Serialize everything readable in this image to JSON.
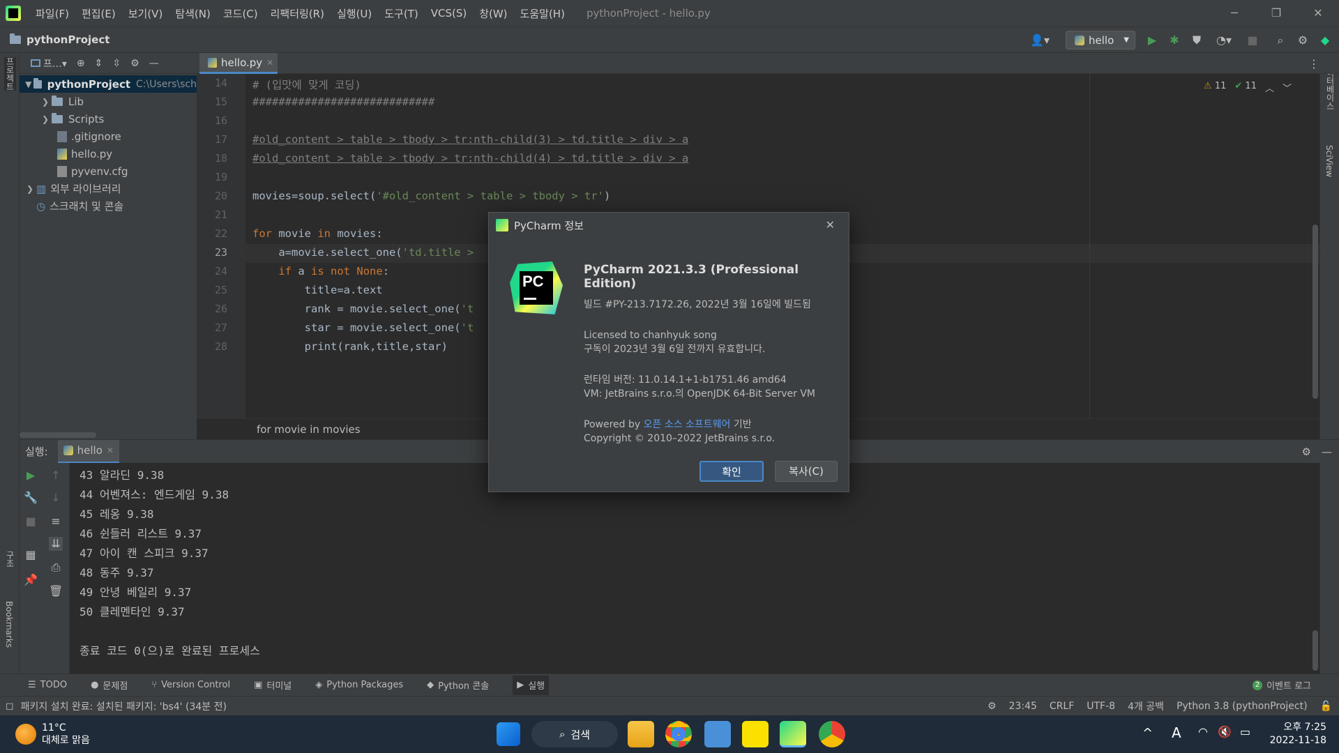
{
  "menu": {
    "items": [
      "파일(F)",
      "편집(E)",
      "보기(V)",
      "탐색(N)",
      "코드(C)",
      "리팩터링(R)",
      "실행(U)",
      "도구(T)",
      "VCS(S)",
      "창(W)",
      "도움말(H)"
    ],
    "window_title": "pythonProject - hello.py"
  },
  "nav": {
    "project": "pythonProject",
    "run_config": "hello"
  },
  "side": {
    "project_label": "프로젝트",
    "structure_label": "구조",
    "bookmarks_label": "Bookmarks",
    "db_label": "데이터베이스",
    "sciview_label": "SciView"
  },
  "project_panel": {
    "dropdown": "프…",
    "root": "pythonProject",
    "root_path": "C:\\Users\\sch",
    "items": [
      "Lib",
      "Scripts",
      ".gitignore",
      "hello.py",
      "pyvenv.cfg"
    ],
    "ext_lib": "외부 라이브러리",
    "scratch": "스크래치 및 콘솔"
  },
  "editor": {
    "tab": "hello.py",
    "warnings": "11",
    "checks": "11",
    "lines": [
      {
        "n": "14",
        "t": "# (입맛에 맞게 코딩)"
      },
      {
        "n": "15",
        "t": "############################"
      },
      {
        "n": "16",
        "t": ""
      },
      {
        "n": "17",
        "t": "#old_content > table > tbody > tr:nth-child(3) > td.title > div > a"
      },
      {
        "n": "18",
        "t": "#old_content > table > tbody > tr:nth-child(4) > td.title > div > a"
      },
      {
        "n": "19",
        "t": ""
      },
      {
        "n": "20",
        "t": "movies=soup.select('#old_content > table > tbody > tr')"
      },
      {
        "n": "21",
        "t": ""
      },
      {
        "n": "22",
        "t": "for movie in movies:"
      },
      {
        "n": "23",
        "t": "    a=movie.select_one('td.title >"
      },
      {
        "n": "24",
        "t": "    if a is not None:"
      },
      {
        "n": "25",
        "t": "        title=a.text"
      },
      {
        "n": "26",
        "t": "        rank = movie.select_one('t"
      },
      {
        "n": "27",
        "t": "        star = movie.select_one('t"
      },
      {
        "n": "28",
        "t": "        print(rank,title,star)"
      }
    ],
    "breadcrumb": "for movie in movies"
  },
  "run": {
    "label": "실행:",
    "tab": "hello",
    "output": [
      "43 알라딘 9.38",
      "44 어벤져스: 엔드게임 9.38",
      "45 레옹 9.38",
      "46 쉰들러 리스트 9.37",
      "47 아이 캔 스피크 9.37",
      "48 동주 9.37",
      "49 안녕 베일리 9.37",
      "50 클레멘타인 9.37",
      "",
      "종료 코드 0(으)로 완료된 프로세스"
    ]
  },
  "toolwindows": {
    "todo": "TODO",
    "problems": "문제점",
    "vcs": "Version Control",
    "terminal": "터미널",
    "packages": "Python Packages",
    "console": "Python 콘솔",
    "run": "실행",
    "event_count": "2",
    "event_log": "이벤트 로그"
  },
  "status": {
    "message": "패키지 설치 완료: 설치된 패키지: 'bs4' (34분 전)",
    "position": "23:45",
    "line_sep": "CRLF",
    "encoding": "UTF-8",
    "indent": "4개 공백",
    "interpreter": "Python 3.8 (pythonProject)"
  },
  "dialog": {
    "title": "PyCharm 정보",
    "product": "PyCharm 2021.3.3 (Professional Edition)",
    "build": "빌드 #PY-213.7172.26, 2022년 3월 16일에 빌드됨",
    "licensed": "Licensed to chanhyuk song",
    "subscription": "구독이 2023년 3월 6일 전까지 유효합니다.",
    "runtime": "런타임 버전: 11.0.14.1+1-b1751.46 amd64",
    "vm": "VM: JetBrains s.r.o.의 OpenJDK 64-Bit Server VM",
    "powered_prefix": "Powered by",
    "powered_link": "오픈 소스 소프트웨어",
    "powered_suffix": "기반",
    "copyright": "Copyright © 2010–2022 JetBrains s.r.o.",
    "ok": "확인",
    "copy": "복사(C)",
    "logo_text": "PC"
  },
  "taskbar": {
    "temp": "11°C",
    "weather": "대체로 맑음",
    "search": "검색",
    "time": "오후 7:25",
    "date": "2022-11-18",
    "ime": "A"
  },
  "colors": {
    "accent": "#4a88c7",
    "link": "#589df6",
    "green": "#499c54"
  }
}
